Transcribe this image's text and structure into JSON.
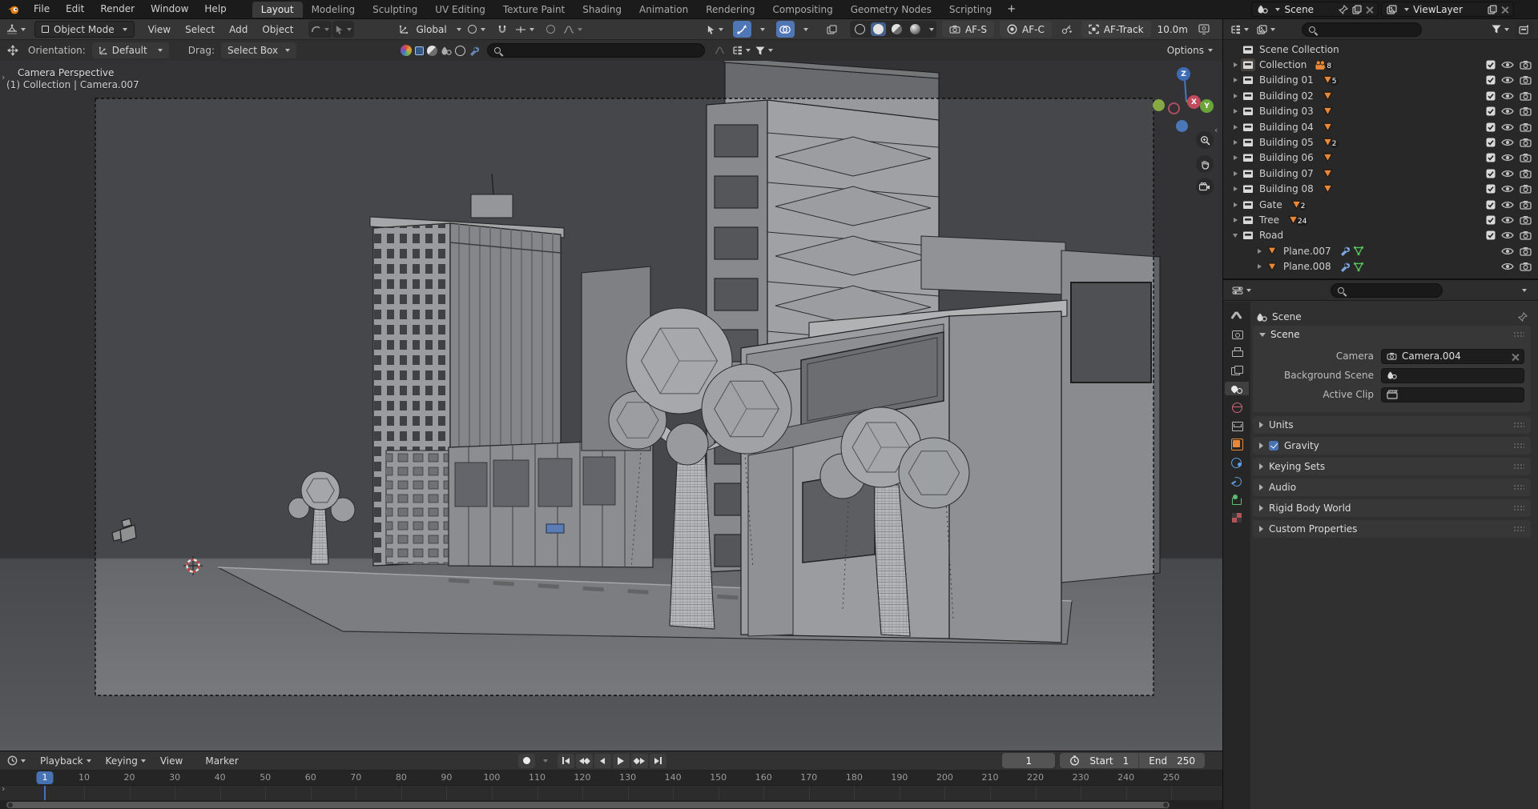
{
  "accent_blue": "#4772b3",
  "mesh_orange": "#e8883a",
  "topbar": {
    "menus": [
      {
        "label": "File"
      },
      {
        "label": "Edit"
      },
      {
        "label": "Render"
      },
      {
        "label": "Window"
      },
      {
        "label": "Help"
      }
    ],
    "tabs": [
      {
        "label": "Layout",
        "state": "active"
      },
      {
        "label": "Modeling",
        "state": ""
      },
      {
        "label": "Sculpting",
        "state": ""
      },
      {
        "label": "UV Editing",
        "state": ""
      },
      {
        "label": "Texture Paint",
        "state": ""
      },
      {
        "label": "Shading",
        "state": ""
      },
      {
        "label": "Animation",
        "state": ""
      },
      {
        "label": "Rendering",
        "state": ""
      },
      {
        "label": "Compositing",
        "state": ""
      },
      {
        "label": "Geometry Nodes",
        "state": ""
      },
      {
        "label": "Scripting",
        "state": ""
      },
      {
        "label": "+",
        "state": "plus"
      }
    ],
    "scene_selector_value": "Scene",
    "viewlayer_selector_value": "ViewLayer"
  },
  "viewport_header": {
    "mode_value": "Object Mode",
    "menus": [
      {
        "label": "View"
      },
      {
        "label": "Select"
      },
      {
        "label": "Add"
      },
      {
        "label": "Object"
      }
    ],
    "orientation_value": "Global",
    "af_s_label": "AF-S",
    "af_c_label": "AF-C",
    "af_track_label": "AF-Track",
    "focus_distance": "10.0m"
  },
  "tool_settings": {
    "orientation_label": "Orientation:",
    "orientation_value": "Default",
    "drag_label": "Drag:",
    "drag_value": "Select Box",
    "options_label": "Options"
  },
  "viewport": {
    "view_label": "Camera Perspective",
    "context_label": "(1) Collection | Camera.007",
    "gizmo_x": "X",
    "gizmo_y": "Y",
    "gizmo_z": "Z"
  },
  "outliner": {
    "root_label": "Scene Collection",
    "rows": [
      {
        "label": "Collection",
        "ind": "",
        "arrow": "r",
        "icon": "coll sel",
        "btype": "cam",
        "badge": "8",
        "ctrl": "full"
      },
      {
        "label": "Building 01",
        "ind": "",
        "arrow": "r",
        "icon": "coll",
        "btype": "mesh",
        "badge": "5",
        "ctrl": "full"
      },
      {
        "label": "Building 02",
        "ind": "",
        "arrow": "r",
        "icon": "coll",
        "btype": "mesh",
        "badge": "",
        "ctrl": "full"
      },
      {
        "label": "Building 03",
        "ind": "",
        "arrow": "r",
        "icon": "coll",
        "btype": "mesh",
        "badge": "",
        "ctrl": "full"
      },
      {
        "label": "Building 04",
        "ind": "",
        "arrow": "r",
        "icon": "coll",
        "btype": "mesh",
        "badge": "",
        "ctrl": "full"
      },
      {
        "label": "Building 05",
        "ind": "",
        "arrow": "r",
        "icon": "coll",
        "btype": "mesh",
        "badge": "2",
        "ctrl": "full"
      },
      {
        "label": "Building 06",
        "ind": "",
        "arrow": "r",
        "icon": "coll",
        "btype": "mesh",
        "badge": "",
        "ctrl": "full"
      },
      {
        "label": "Building 07",
        "ind": "",
        "arrow": "r",
        "icon": "coll",
        "btype": "mesh",
        "badge": "",
        "ctrl": "full"
      },
      {
        "label": "Building 08",
        "ind": "",
        "arrow": "r",
        "icon": "coll",
        "btype": "mesh",
        "badge": "",
        "ctrl": "full"
      },
      {
        "label": "Gate",
        "ind": "",
        "arrow": "r",
        "icon": "coll",
        "btype": "mesh",
        "badge": "2",
        "ctrl": "full"
      },
      {
        "label": "Tree",
        "ind": "",
        "arrow": "r",
        "icon": "coll",
        "btype": "mesh",
        "badge": "24",
        "ctrl": "full"
      },
      {
        "label": "Road",
        "ind": "",
        "arrow": "d",
        "icon": "coll",
        "btype": "",
        "badge": "",
        "ctrl": "full"
      },
      {
        "label": "Plane.007",
        "ind": "i2",
        "arrow": "r",
        "icon": "mesh",
        "btype": "mods",
        "badge": "",
        "ctrl": "nocheck"
      },
      {
        "label": "Plane.008",
        "ind": "i2",
        "arrow": "r",
        "icon": "mesh",
        "btype": "mods",
        "badge": "",
        "ctrl": "nocheck"
      }
    ]
  },
  "properties": {
    "tabs": [
      {
        "n": "tool"
      },
      {
        "n": "render"
      },
      {
        "n": "output"
      },
      {
        "n": "viewlayer"
      },
      {
        "n": "scene"
      },
      {
        "n": "world"
      },
      {
        "n": "collection"
      },
      {
        "n": "object"
      },
      {
        "n": "physics"
      },
      {
        "n": "constraints"
      },
      {
        "n": "data"
      },
      {
        "n": "texture"
      }
    ],
    "breadcrumb": "Scene",
    "scene_panel_title": "Scene",
    "camera_label": "Camera",
    "camera_value": "Camera.004",
    "background_scene_label": "Background Scene",
    "active_clip_label": "Active Clip",
    "sections": [
      {
        "label": "Units",
        "check": ""
      },
      {
        "label": "Gravity",
        "check": "yes"
      },
      {
        "label": "Keying Sets",
        "check": ""
      },
      {
        "label": "Audio",
        "check": ""
      },
      {
        "label": "Rigid Body World",
        "check": ""
      },
      {
        "label": "Custom Properties",
        "check": ""
      }
    ]
  },
  "timeline": {
    "menus": [
      {
        "label": "Playback",
        "car": "on"
      },
      {
        "label": "Keying",
        "car": "on"
      },
      {
        "label": "View",
        "car": ""
      },
      {
        "label": "Marker",
        "car": ""
      }
    ],
    "current_frame": "1",
    "playhead_label": "1",
    "start_label": "Start",
    "start_value": "1",
    "end_label": "End",
    "end_value": "250",
    "ticks": [
      {
        "t": "10"
      },
      {
        "t": "20"
      },
      {
        "t": "30"
      },
      {
        "t": "40"
      },
      {
        "t": "50"
      },
      {
        "t": "60"
      },
      {
        "t": "70"
      },
      {
        "t": "80"
      },
      {
        "t": "90"
      },
      {
        "t": "100"
      },
      {
        "t": "110"
      },
      {
        "t": "120"
      },
      {
        "t": "130"
      },
      {
        "t": "140"
      },
      {
        "t": "150"
      },
      {
        "t": "160"
      },
      {
        "t": "170"
      },
      {
        "t": "180"
      },
      {
        "t": "190"
      },
      {
        "t": "200"
      },
      {
        "t": "210"
      },
      {
        "t": "220"
      },
      {
        "t": "230"
      },
      {
        "t": "240"
      },
      {
        "t": "250"
      }
    ]
  }
}
